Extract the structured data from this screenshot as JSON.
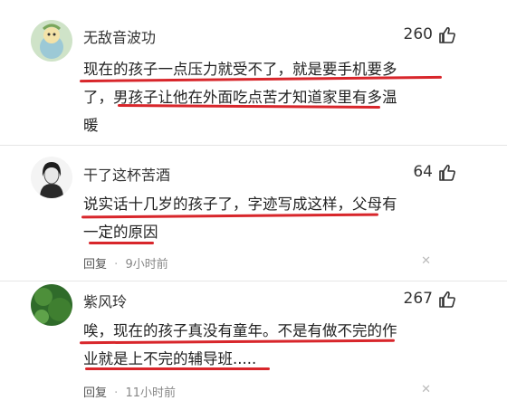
{
  "comments": [
    {
      "username": "无敌音波功",
      "likes": "260",
      "lines": [
        "现在的孩子一点压力就受不了，就是要手机要多",
        "了，男孩子让他在外面吃点苦才知道家里有多温",
        "暖"
      ],
      "avatar_icon": "cartoon-avatar-icon",
      "reply_label": "",
      "time": ""
    },
    {
      "username": "干了这杯苦酒",
      "likes": "64",
      "lines": [
        "说实话十几岁的孩子了，字迹写成这样，父母有",
        "一定的原因"
      ],
      "avatar_icon": "sketch-portrait-avatar-icon",
      "reply_label": "回复",
      "time": "9小时前"
    },
    {
      "username": "紫风玲",
      "likes": "267",
      "lines": [
        "唉，现在的孩子真没有童年。不是有做不完的作",
        "业就是上不完的辅导班....."
      ],
      "avatar_icon": "green-nature-avatar-icon",
      "reply_label": "回复",
      "time": "11小时前"
    }
  ],
  "separator": "·",
  "underline_color": "#d8262b"
}
